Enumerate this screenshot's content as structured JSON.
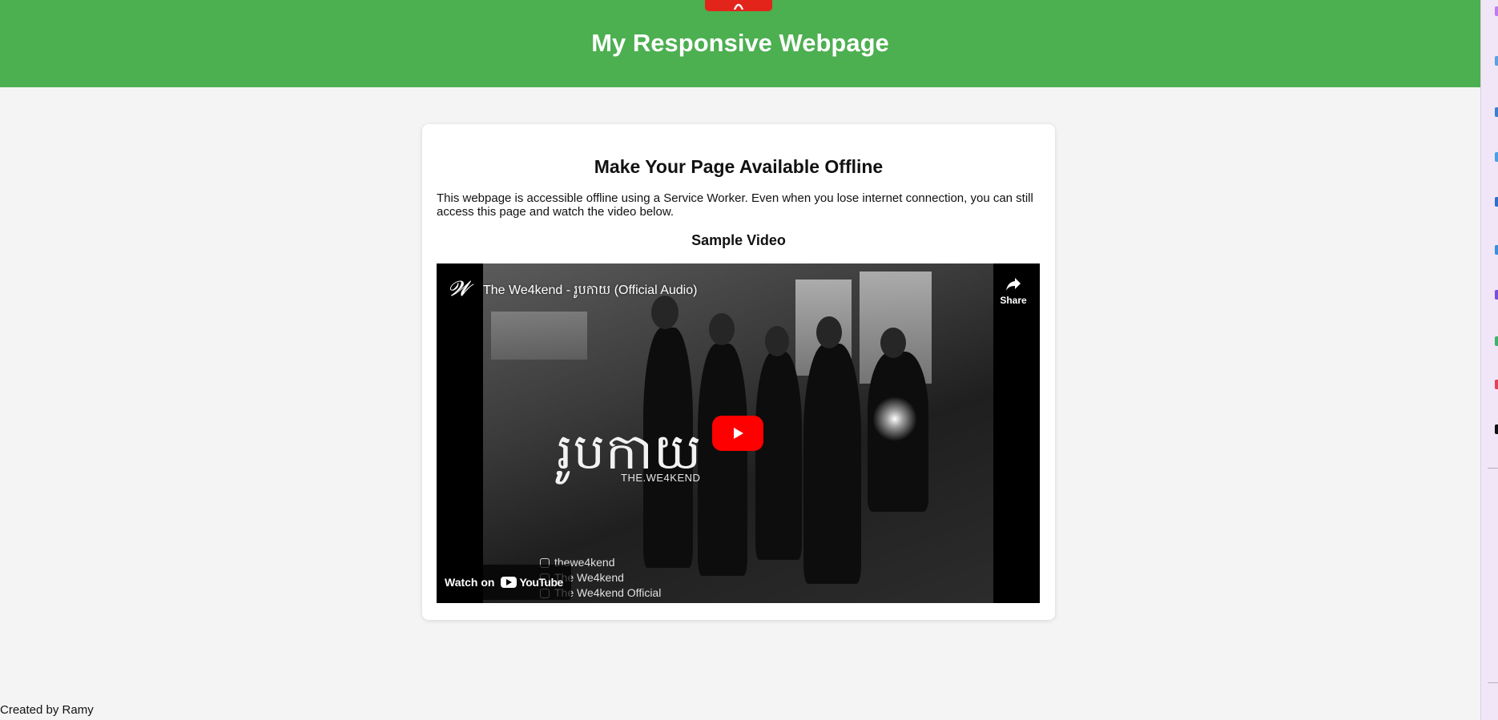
{
  "header": {
    "title": "My Responsive Webpage",
    "accent": "#4caf50"
  },
  "card": {
    "title": "Make Your Page Available Offline",
    "description": "This webpage is accessible offline using a Service Worker. Even when you lose internet connection, you can still access this page and watch the video below.",
    "subtitle": "Sample Video"
  },
  "video": {
    "title": "The We4kend - រូបកាយ (Official Audio)",
    "share_label": "Share",
    "watch_on_label": "Watch on",
    "youtube_label": "YouTube",
    "art_title": "រូបកាយ",
    "art_subtitle": "THE.WE4KEND",
    "social": [
      {
        "icon": "instagram-icon",
        "text": "thewe4kend"
      },
      {
        "icon": "facebook-icon",
        "text": "The We4kend"
      },
      {
        "icon": "youtube-icon",
        "text": "The We4kend Official"
      }
    ],
    "play_color": "#ff0000"
  },
  "footer": {
    "text": "Created by Ramy"
  }
}
